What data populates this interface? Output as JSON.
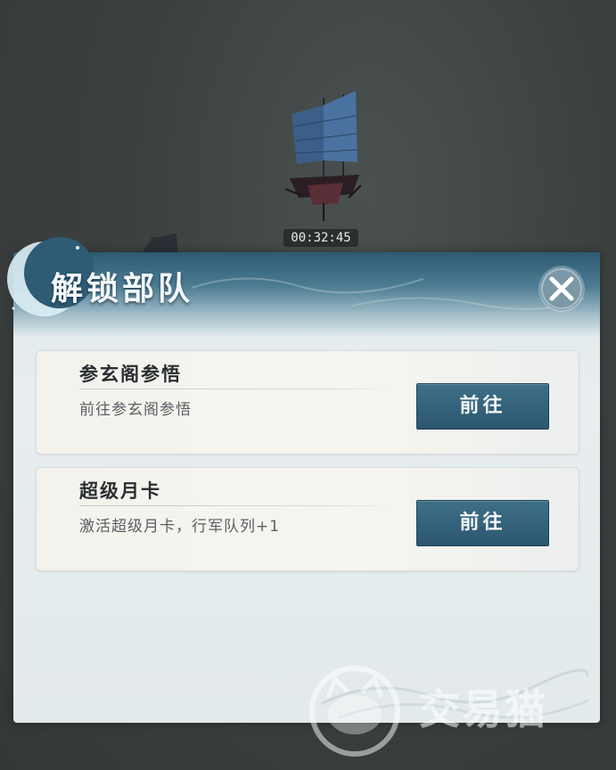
{
  "scene": {
    "timer": "00:32:45",
    "ship_color": "#3b5f88"
  },
  "dialog": {
    "title": "解锁部队",
    "close_icon": "close-x-icon",
    "cards": [
      {
        "title": "参玄阁参悟",
        "description": "前往参玄阁参悟",
        "button_label": "前往"
      },
      {
        "title": "超级月卡",
        "description": "激活超级月卡，行军队列+1",
        "button_label": "前往"
      }
    ]
  },
  "watermark": {
    "text": "交易猫",
    "icon": "cat-logo-icon"
  },
  "colors": {
    "header_blue": "#2d5a73",
    "button_blue": "#2b566f",
    "card_bg": "#f6f4ee"
  }
}
